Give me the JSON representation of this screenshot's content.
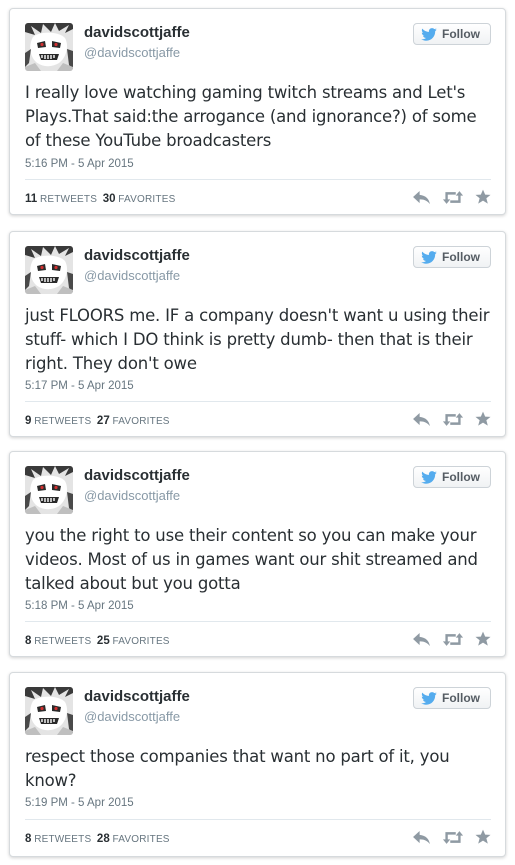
{
  "colors": {
    "text": "#292f33",
    "muted": "#66757f",
    "handle": "#8899a6",
    "twitter_blue": "#55acee",
    "action_grey": "#8f9aa3"
  },
  "follow_label": "Follow",
  "tweets": [
    {
      "name": "davidscottjaffe",
      "handle": "@davidscottjaffe",
      "text": "I really love watching gaming twitch streams and Let's Plays.That said:the arrogance (and ignorance?) of some of these YouTube broadcasters",
      "timestamp": "5:16 PM - 5 Apr 2015",
      "retweets": "11",
      "retweets_label": "RETWEETS",
      "favorites": "30",
      "favorites_label": "FAVORITES"
    },
    {
      "name": "davidscottjaffe",
      "handle": "@davidscottjaffe",
      "text": "just FLOORS me. IF a company doesn't want u using their stuff- which I DO think is pretty dumb- then that is their right. They don't owe",
      "timestamp": "5:17 PM - 5 Apr 2015",
      "retweets": "9",
      "retweets_label": "RETWEETS",
      "favorites": "27",
      "favorites_label": "FAVORITES"
    },
    {
      "name": "davidscottjaffe",
      "handle": "@davidscottjaffe",
      "text": "you the right to use their content so you can make your videos. Most of us in games want our shit streamed and talked about but you gotta",
      "timestamp": "5:18 PM - 5 Apr 2015",
      "retweets": "8",
      "retweets_label": "RETWEETS",
      "favorites": "25",
      "favorites_label": "FAVORITES"
    },
    {
      "name": "davidscottjaffe",
      "handle": "@davidscottjaffe",
      "text": "respect those companies that want no part of it, you know?",
      "timestamp": "5:19 PM - 5 Apr 2015",
      "retweets": "8",
      "retweets_label": "RETWEETS",
      "favorites": "28",
      "favorites_label": "FAVORITES"
    }
  ]
}
